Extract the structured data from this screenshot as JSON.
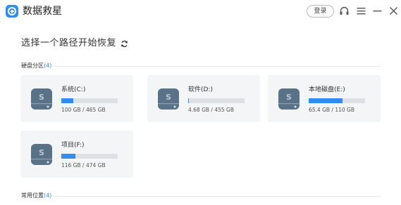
{
  "app": {
    "title": "数据救星"
  },
  "toolbar": {
    "login_label": "登录",
    "icons": [
      "headset-icon",
      "menu-icon",
      "minimize-icon",
      "close-icon"
    ]
  },
  "heading": {
    "text": "选择一个路径开始恢复",
    "refresh_icon": "refresh-icon"
  },
  "sections": {
    "disks": {
      "label": "硬盘分区",
      "count": "(4)"
    },
    "common": {
      "label": "常用位置",
      "count": "(4)"
    }
  },
  "drives": [
    {
      "name": "系统(C:)",
      "size": "100 GB / 465 GB",
      "used_fraction": 0.215
    },
    {
      "name": "软件(D:)",
      "size": "4.68 GB / 455 GB",
      "used_fraction": 0.01
    },
    {
      "name": "本地磁盘(E:)",
      "size": "65.4 GB / 110 GB",
      "used_fraction": 0.595
    },
    {
      "name": "项目(F:)",
      "size": "116 GB / 474 GB",
      "used_fraction": 0.245
    }
  ],
  "colors": {
    "accent": "#2f8df5",
    "card_bg": "#f4f5f7",
    "drive_icon": "#5a7287"
  }
}
